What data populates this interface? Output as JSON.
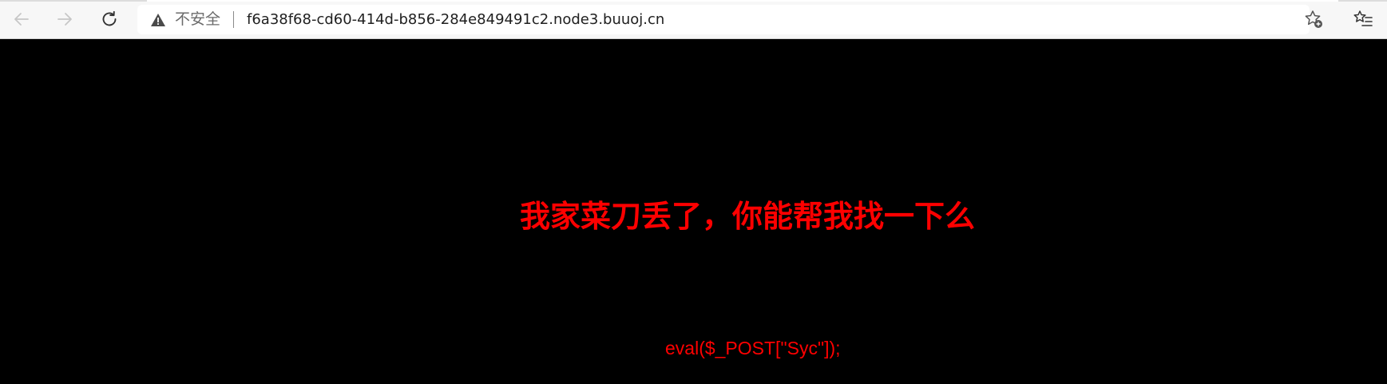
{
  "browser": {
    "security_label": "不安全",
    "url": "f6a38f68-cd60-414d-b856-284e849491c2.node3.buuoj.cn",
    "icons": {
      "back": "arrow-left-icon",
      "forward": "arrow-right-icon",
      "reload": "reload-icon",
      "warning": "warning-triangle-icon",
      "favorite": "star-add-icon",
      "favorites": "favorites-list-icon"
    }
  },
  "page": {
    "headline": "我家菜刀丢了，你能帮我找一下么",
    "code_hint": "eval($_POST[\"Syc\"]);",
    "colors": {
      "background": "#000000",
      "text": "#ff0000"
    }
  }
}
